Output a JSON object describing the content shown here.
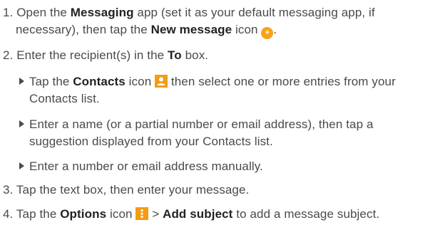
{
  "step1": {
    "num": "1.",
    "line1_a": "Open the ",
    "line1_app": "Messaging",
    "line1_b": " app (set it as your default messaging app, if",
    "line2_a": "necessary), then tap the ",
    "line2_icon_label": "New message",
    "line2_b": " icon ",
    "line2_c": ".",
    "icon": "new-message-plus-icon"
  },
  "step2": {
    "num": "2.",
    "text_a": "Enter the recipient(s) in the ",
    "text_field": "To",
    "text_b": " box.",
    "bullets": [
      {
        "line1_a": "Tap the ",
        "line1_bold": "Contacts",
        "line1_b": " icon ",
        "line1_c": " then select one or more entries from your",
        "line2": "Contacts list.",
        "icon": "contacts-icon"
      },
      {
        "line1": "Enter a name (or a partial number or email address), then tap a",
        "line2": "suggestion displayed from your Contacts list."
      },
      {
        "line1": "Enter a number or email address manually."
      }
    ]
  },
  "step3": {
    "num": "3.",
    "text": "Tap the text box, then enter your message."
  },
  "step4": {
    "num": "4.",
    "text_a": "Tap the ",
    "text_bold": "Options",
    "text_b": " icon ",
    "text_c": " > ",
    "text_bold2": "Add subject",
    "text_d": " to add a message subject.",
    "icon": "options-icon"
  },
  "colors": {
    "text": "#4a4a4a",
    "accent": "#f39c14"
  }
}
